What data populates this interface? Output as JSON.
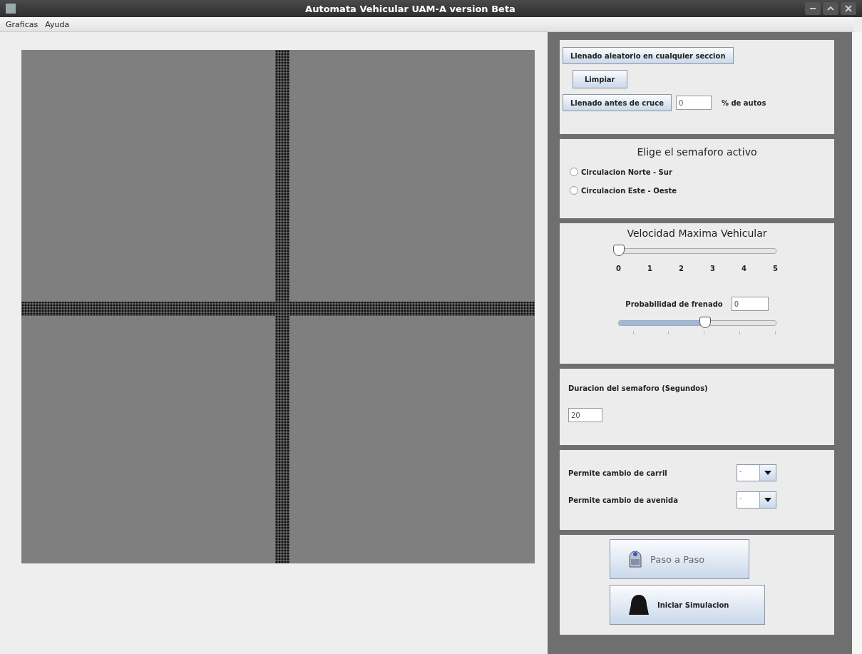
{
  "window": {
    "title": "Automata Vehicular UAM-A version  Beta"
  },
  "menu": [
    {
      "label": "Graficas"
    },
    {
      "label": "Ayuda"
    }
  ],
  "fill_panel": {
    "random_button": "Llenado aleatorio en cualquier seccion",
    "clear_button": "Limpiar",
    "before_cross_button": "Llenado antes de cruce",
    "percent_value": "0",
    "percent_label": "% de autos"
  },
  "light_panel": {
    "title": "Elige el semaforo activo",
    "options": [
      {
        "label": "Circulacion Norte - Sur",
        "selected": false
      },
      {
        "label": "Circulacion Este - Oeste",
        "selected": false
      }
    ]
  },
  "speed_panel": {
    "title": "Velocidad Maxima Vehicular",
    "speed_slider": {
      "level": 0,
      "ticks": [
        "0",
        "1",
        "2",
        "3",
        "4",
        "5"
      ]
    },
    "braking_label": "Probabilidad de frenado",
    "braking_value": "0",
    "braking_slider": {
      "level": 0.55
    }
  },
  "duration_panel": {
    "label": "Duracion del semaforo (Segundos)",
    "value": "20"
  },
  "change_panel": {
    "rows": [
      {
        "label": "Permite cambio de carril",
        "value": "-"
      },
      {
        "label": "Permite cambio de avenida",
        "value": "-"
      }
    ]
  },
  "actions": [
    {
      "label": "Paso a Paso",
      "kind": "robot"
    },
    {
      "label": "Iniciar Simulacion",
      "kind": "helmet"
    }
  ]
}
